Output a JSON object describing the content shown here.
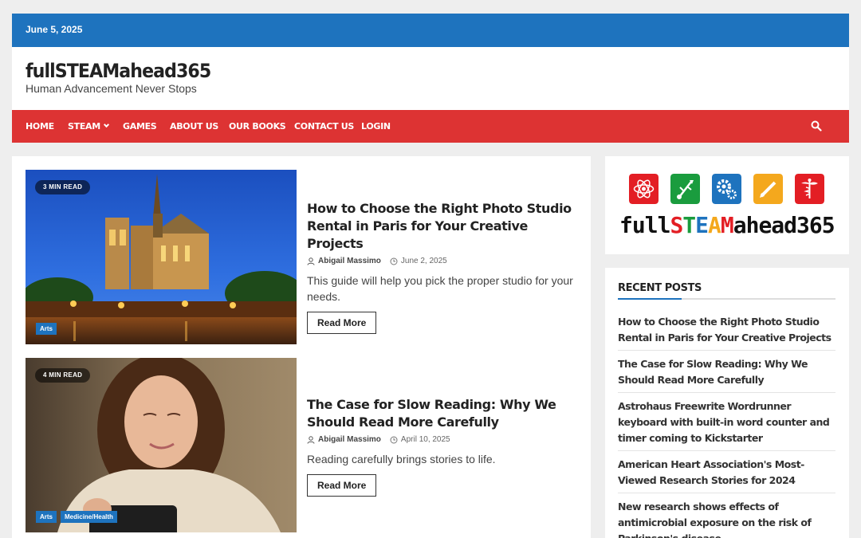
{
  "topbar": {
    "date": "June 5, 2025"
  },
  "header": {
    "site_title": "fullSTEAMahead365",
    "site_description": "Human Advancement Never Stops"
  },
  "nav": {
    "items": [
      "HOME",
      "STEAM",
      "GAMES",
      "ABOUT US",
      "OUR BOOKS",
      "CONTACT US",
      "LOGIN"
    ]
  },
  "posts": [
    {
      "read_time": "3 MIN READ",
      "title": "How to Choose the Right Photo Studio Rental in Paris for Your Creative Projects",
      "author": "Abigail Massimo",
      "date": "June 2, 2025",
      "excerpt": "This guide will help you pick the proper studio for your needs.",
      "read_more": "Read More",
      "categories": [
        "Arts"
      ]
    },
    {
      "read_time": "4 MIN READ",
      "title": "The Case for Slow Reading: Why We Should Read More Carefully",
      "author": "Abigail Massimo",
      "date": "April 10, 2025",
      "excerpt": "Reading carefully brings stories to life.",
      "read_more": "Read More",
      "categories": [
        "Arts",
        "Medicine/Health"
      ]
    }
  ],
  "sidebar": {
    "logo_text": "fullSTEAMahead365",
    "logo_icons": [
      "atom-icon",
      "usb-icon",
      "gears-icon",
      "pencil-icon",
      "caduceus-icon"
    ],
    "recent_title": "RECENT POSTS",
    "recent_posts": [
      "How to Choose the Right Photo Studio Rental in Paris for Your Creative Projects",
      "The Case for Slow Reading: Why We Should Read More Carefully",
      "Astrohaus Freewrite Wordrunner keyboard with built-in word counter and timer coming to Kickstarter",
      "American Heart Association's Most-Viewed Research Stories for 2024",
      "New research shows effects of antimicrobial exposure on the risk of Parkinson's disease"
    ]
  },
  "colors": {
    "topbar": "#1e73be",
    "navbar": "#dd3333",
    "accent": "#1e73be",
    "logo_s": "#e31e24",
    "logo_t": "#1a9c3e",
    "logo_e": "#1e73be",
    "logo_a": "#f4a81d",
    "logo_m": "#e31e24"
  }
}
